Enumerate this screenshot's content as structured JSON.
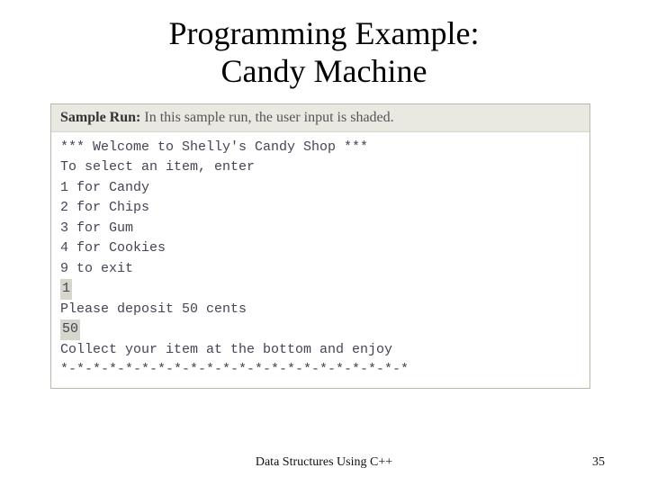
{
  "title": {
    "line1": "Programming Example:",
    "line2": "Candy Machine"
  },
  "sample": {
    "header_label": "Sample Run:",
    "header_text": " In this sample run, the user input is shaded.",
    "lines": {
      "l0": "*** Welcome to Shelly's Candy Shop ***",
      "l1": "To select an item, enter",
      "l2": "1 for Candy",
      "l3": "2 for Chips",
      "l4": "3 for Gum",
      "l5": "4 for Cookies",
      "l6": "9 to exit",
      "input1": "1",
      "l7": "Please deposit 50 cents",
      "input2": "50",
      "l8": "Collect your item at the bottom and enjoy",
      "l9": "*-*-*-*-*-*-*-*-*-*-*-*-*-*-*-*-*-*-*-*-*-*"
    }
  },
  "footer": {
    "center": "Data Structures Using C++",
    "page": "35"
  }
}
